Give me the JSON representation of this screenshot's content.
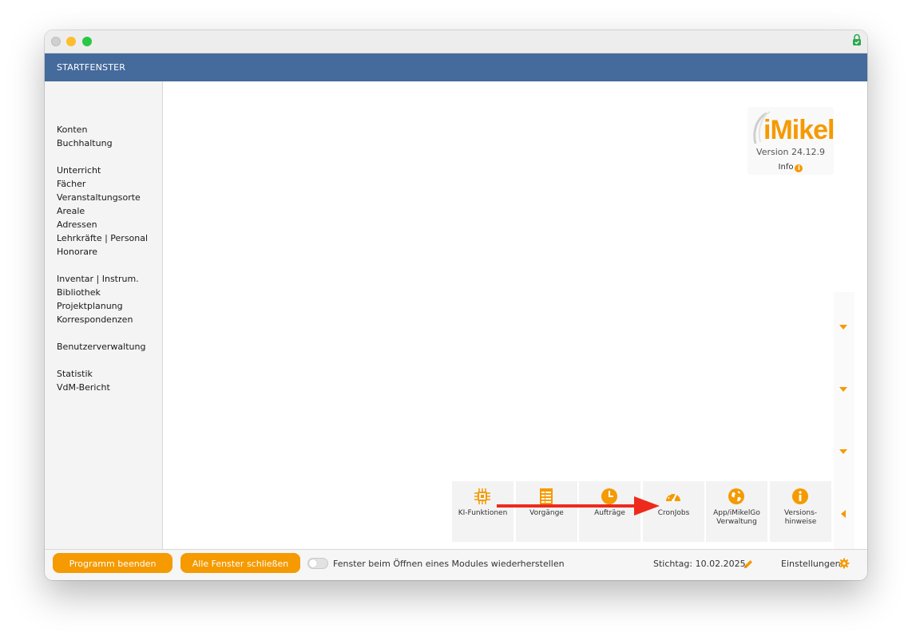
{
  "window": {
    "header_title": "STARTFENSTER"
  },
  "sidebar": {
    "groups": [
      [
        "Konten",
        "Buchhaltung"
      ],
      [
        "Unterricht",
        "Fächer",
        "Veranstaltungsorte",
        "Areale",
        "Adressen",
        "Lehrkräfte | Personal",
        "Honorare"
      ],
      [
        "Inventar | Instrum.",
        "Bibliothek",
        "Projektplanung",
        "Korrespondenzen"
      ],
      [
        "Benutzerverwaltung"
      ],
      [
        "Statistik",
        "VdM-Bericht"
      ]
    ]
  },
  "brand": {
    "logo_text": "iMikel",
    "version": "Version 24.12.9",
    "info_label": "Info",
    "info_icon": "info-circle-icon"
  },
  "tiles": [
    {
      "label": "KI-Funktionen",
      "icon": "chip-icon"
    },
    {
      "label": "Vorgänge",
      "icon": "document-list-icon"
    },
    {
      "label": "Aufträge",
      "icon": "clock-icon"
    },
    {
      "label": "CronJobs",
      "icon": "gauge-icon"
    },
    {
      "label": "App/iMikelGo\nVerwaltung",
      "icon": "globe-icon"
    },
    {
      "label": "Versions-\nhinweise",
      "icon": "info-icon"
    }
  ],
  "footer": {
    "quit_button": "Programm beenden",
    "close_all_button": "Alle Fenster schließen",
    "restore_toggle_label": "Fenster beim Öffnen eines Modules wiederherstellen",
    "restore_toggle_on": false,
    "reference_date": "Stichtag: 10.02.2025",
    "settings_label": "Einstellungen"
  },
  "colors": {
    "header_bg": "#456a9c",
    "accent": "#f59a00",
    "annotation_arrow": "#ee2a1c"
  }
}
